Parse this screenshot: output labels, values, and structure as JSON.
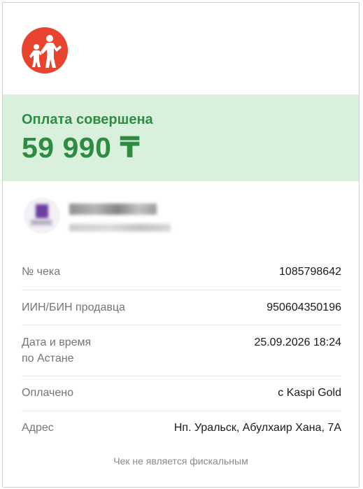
{
  "colors": {
    "brand_red": "#e8432e",
    "success_green": "#2e8c42",
    "banner_bg": "#d9f0dc"
  },
  "logo": {
    "icon": "two-people-brand-logo"
  },
  "status": {
    "title": "Оплата совершена",
    "amount": "59 990 ₸"
  },
  "receipt": {
    "check_no": {
      "label": "№ чека",
      "value": "1085798642"
    },
    "seller_iin": {
      "label": "ИИН/БИН продавца",
      "value": "950604350196"
    },
    "datetime": {
      "label_line1": "Дата и время",
      "label_line2": "по Астане",
      "value": "25.09.2026 18:24"
    },
    "paid": {
      "label": "Оплачено",
      "value": "с Kaspi Gold"
    },
    "address": {
      "label": "Адрес",
      "value": "Нп. Уральск, Абулхаир Хана, 7А"
    }
  },
  "footer_note": "Чек не является фискальным"
}
